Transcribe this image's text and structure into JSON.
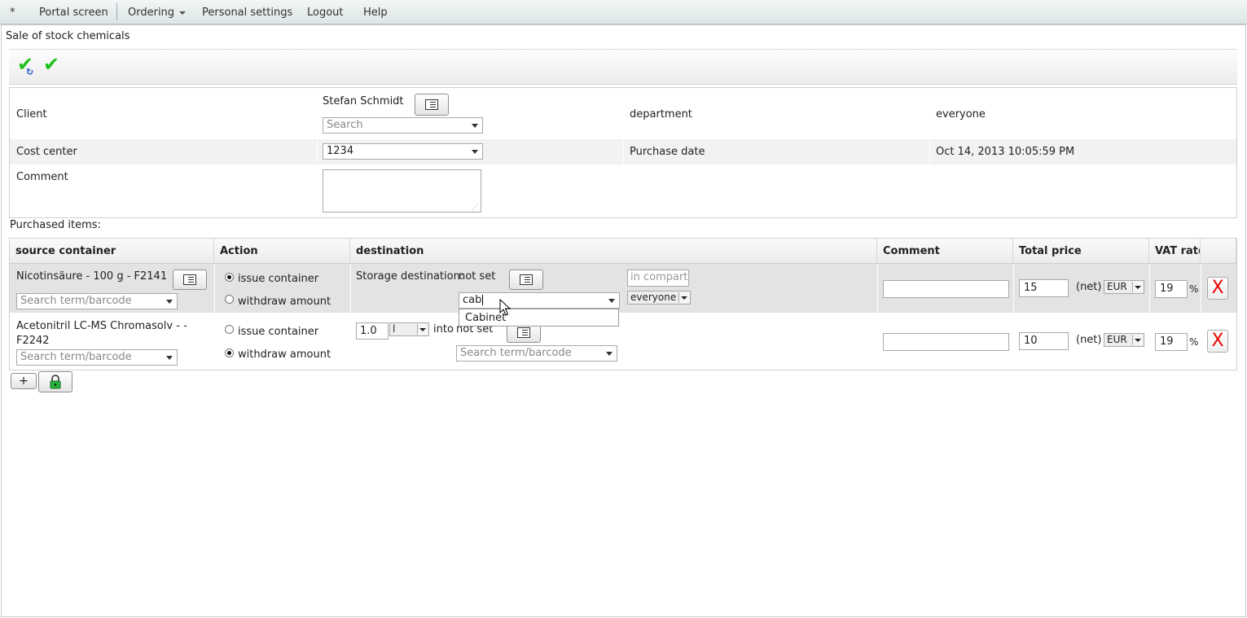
{
  "menubar": {
    "items": [
      "*",
      "Portal screen",
      "Ordering",
      "Personal settings",
      "Logout",
      "Help"
    ]
  },
  "page": {
    "title": "Sale of stock chemicals"
  },
  "toolbar": {
    "icons": [
      "save-and-continue-icon",
      "save-icon"
    ],
    "color": "#1fc019"
  },
  "form": {
    "client_label": "Client",
    "client_name": "Stefan Schmidt",
    "client_search_placeholder": "Search",
    "department_label": "department",
    "department_value": "everyone",
    "cost_center_label": "Cost center",
    "cost_center_value": "1234",
    "purchase_date_label": "Purchase date",
    "purchase_date_value": "Oct 14, 2013 10:05:59 PM",
    "comment_label": "Comment",
    "comment_value": ""
  },
  "items": {
    "label": "Purchased items:",
    "columns": [
      "source container",
      "Action",
      "destination",
      "Comment",
      "Total price",
      "VAT rate"
    ],
    "rows": [
      {
        "source": "Nicotinsäure - 100 g - F2141",
        "search_placeholder": "Search term/barcode",
        "action_issue": "issue container",
        "action_withdraw": "withdraw amount",
        "selected_action": "issue container",
        "storage_label": "Storage destination:",
        "storage_value": "not set",
        "destination_input": "cab",
        "compartment_placeholder": "in compartment",
        "owner": "everyone",
        "comment": "",
        "price": "15",
        "net": "(net)",
        "currency": "EUR",
        "vat": "19",
        "vat_unit": "%",
        "delete": "X"
      },
      {
        "source_line1": "Acetonitril LC-MS Chromasolv - -",
        "source_line2": "F2242",
        "search_placeholder": "Search term/barcode",
        "action_issue": "issue container",
        "action_withdraw": "withdraw amount",
        "selected_action": "withdraw amount",
        "amount": "1.0",
        "unit": "l",
        "into": "into",
        "into_value": "not set",
        "dest_search_placeholder": "Search term/barcode",
        "comment": "",
        "price": "10",
        "net": "(net)",
        "currency": "EUR",
        "vat": "19",
        "vat_unit": "%",
        "delete": "X"
      }
    ],
    "add_label": "+",
    "lock_icon": "lock-icon"
  },
  "autocomplete": {
    "options": [
      "Cabinet"
    ]
  }
}
